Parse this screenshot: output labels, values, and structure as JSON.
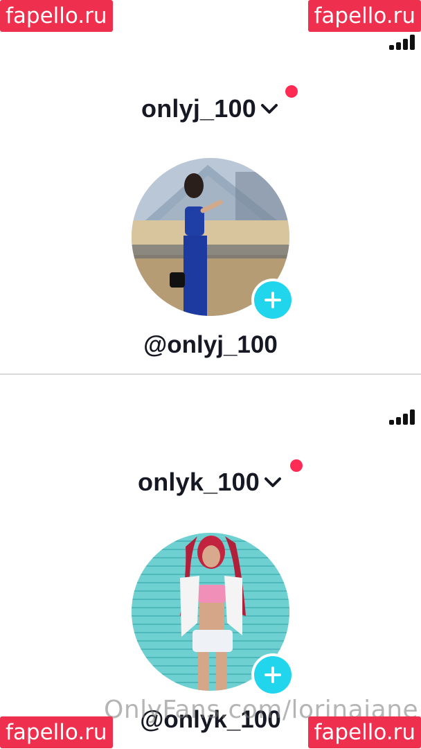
{
  "watermarks": {
    "site": "fapello.ru",
    "overlay": "OnlyFans.com/lorinajane"
  },
  "profiles": [
    {
      "username": "onlyj_100",
      "handle": "@onlyj_100",
      "avatar_icon": "avatar-photo-blue-outfit",
      "add_icon": "plus-icon"
    },
    {
      "username": "onlyk_100",
      "handle": "@onlyk_100",
      "avatar_icon": "avatar-photo-red-hair",
      "add_icon": "plus-icon"
    }
  ],
  "colors": {
    "notification_dot": "#fe2c55",
    "add_button": "#20d5ec",
    "watermark_bg": "#ee2f4d",
    "text": "#161823"
  }
}
